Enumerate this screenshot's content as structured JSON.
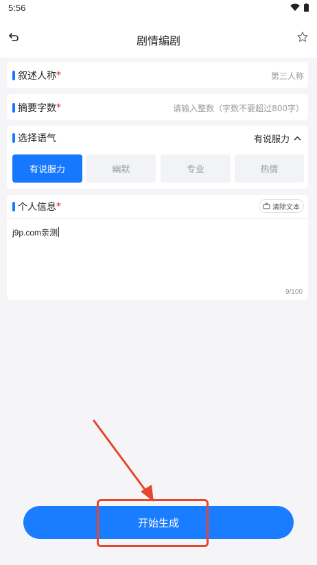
{
  "status_bar": {
    "time": "5:56",
    "icons": [
      "wifi-icon",
      "battery-icon"
    ]
  },
  "header": {
    "title": "剧情编剧",
    "back_icon": "back-icon",
    "favorite_icon": "star-icon"
  },
  "narration": {
    "label": "叙述人称",
    "required_mark": "*",
    "value": "第三人称"
  },
  "summary_length": {
    "label": "摘要字数",
    "required_mark": "*",
    "placeholder": "请输入整数（字数不要超过800字）"
  },
  "tone": {
    "label": "选择语气",
    "selected": "有说服力",
    "options": [
      "有说服力",
      "幽默",
      "专业",
      "热情"
    ]
  },
  "personal_info": {
    "label": "个人信息",
    "required_mark": "*",
    "clear_label": "清除文本",
    "text": "j9p.com亲测",
    "counter": "9/100"
  },
  "start_button": {
    "label": "开始生成"
  },
  "colors": {
    "accent": "#1677ff",
    "annotation": "#e5462e",
    "required": "#e02424"
  }
}
